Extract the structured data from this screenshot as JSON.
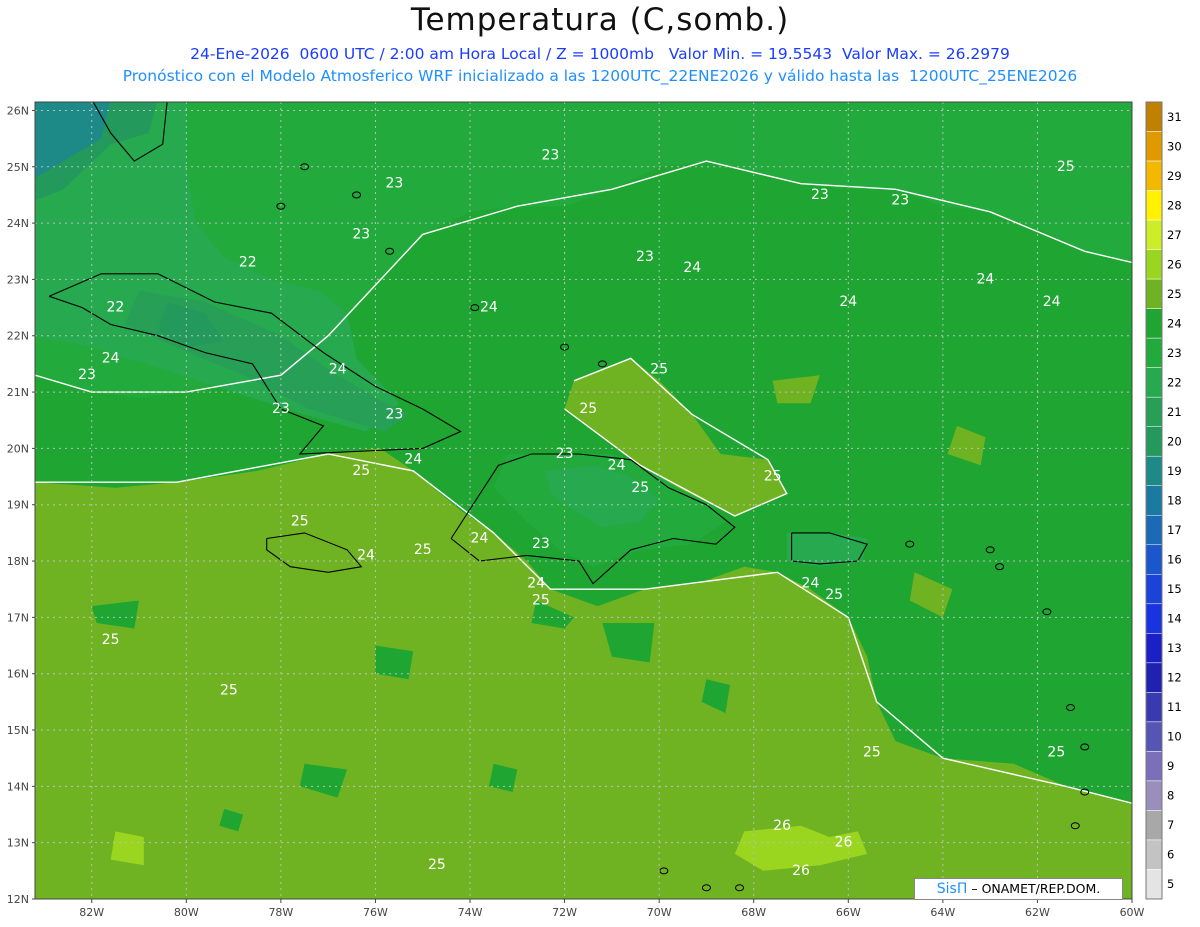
{
  "header": {
    "title": "Temperatura (C,somb.)",
    "line1": "24-Ene-2026  0600 UTC / 2:00 am Hora Local / Z = 1000mb   Valor Min. = 19.5543  Valor Max. = 26.2979",
    "line2": "Pronóstico con el Modelo Atmosferico WRF inicializado a las 1200UTC_22ENE2026 y válido hasta las  1200UTC_25ENE2026"
  },
  "map": {
    "lat_labels": [
      "26N",
      "25N",
      "24N",
      "23N",
      "22N",
      "21N",
      "20N",
      "19N",
      "18N",
      "17N",
      "16N",
      "15N",
      "14N",
      "13N",
      "12N"
    ],
    "lon_labels": [
      "82W",
      "80W",
      "78W",
      "76W",
      "74W",
      "72W",
      "70W",
      "68W",
      "66W",
      "64W",
      "62W",
      "60W"
    ],
    "colors": {
      "c19": "#1e8a87",
      "c20": "#239a5c",
      "c21": "#279f57",
      "c22": "#26a94f",
      "c23": "#22aa3c",
      "c24": "#1fa632",
      "c25": "#70b322",
      "c26": "#9ad61f",
      "grid": "#bdbdbd",
      "contour": "#ffffff",
      "coast": "#000000"
    },
    "contour_labels": [
      {
        "text": "23",
        "lon": -72.3,
        "lat": 25.2
      },
      {
        "text": "23",
        "lon": -75.6,
        "lat": 24.7
      },
      {
        "text": "23",
        "lon": -76.3,
        "lat": 23.8
      },
      {
        "text": "22",
        "lon": -78.7,
        "lat": 23.3
      },
      {
        "text": "22",
        "lon": -81.5,
        "lat": 22.5
      },
      {
        "text": "24",
        "lon": -81.6,
        "lat": 21.6
      },
      {
        "text": "23",
        "lon": -82.1,
        "lat": 21.3
      },
      {
        "text": "24",
        "lon": -73.6,
        "lat": 22.5
      },
      {
        "text": "24",
        "lon": -76.8,
        "lat": 21.4
      },
      {
        "text": "23",
        "lon": -78.0,
        "lat": 20.7
      },
      {
        "text": "23",
        "lon": -75.6,
        "lat": 20.6
      },
      {
        "text": "24",
        "lon": -75.2,
        "lat": 19.8
      },
      {
        "text": "25",
        "lon": -76.3,
        "lat": 19.6
      },
      {
        "text": "24",
        "lon": -69.3,
        "lat": 23.2
      },
      {
        "text": "25",
        "lon": -70.0,
        "lat": 21.4
      },
      {
        "text": "25",
        "lon": -71.5,
        "lat": 20.7
      },
      {
        "text": "23",
        "lon": -72.0,
        "lat": 19.9
      },
      {
        "text": "24",
        "lon": -70.9,
        "lat": 19.7
      },
      {
        "text": "25",
        "lon": -70.4,
        "lat": 19.3
      },
      {
        "text": "25",
        "lon": -67.6,
        "lat": 19.5
      },
      {
        "text": "23",
        "lon": -70.3,
        "lat": 23.4
      },
      {
        "text": "23",
        "lon": -66.6,
        "lat": 24.5
      },
      {
        "text": "23",
        "lon": -64.9,
        "lat": 24.4
      },
      {
        "text": "24",
        "lon": -66.0,
        "lat": 22.6
      },
      {
        "text": "24",
        "lon": -63.1,
        "lat": 23.0
      },
      {
        "text": "24",
        "lon": -61.7,
        "lat": 22.6
      },
      {
        "text": "25",
        "lon": -61.4,
        "lat": 25.0
      },
      {
        "text": "25",
        "lon": -77.6,
        "lat": 18.7
      },
      {
        "text": "24",
        "lon": -76.2,
        "lat": 18.1
      },
      {
        "text": "25",
        "lon": -75.0,
        "lat": 18.2
      },
      {
        "text": "24",
        "lon": -73.8,
        "lat": 18.4
      },
      {
        "text": "23",
        "lon": -72.5,
        "lat": 18.3
      },
      {
        "text": "24",
        "lon": -72.6,
        "lat": 17.6
      },
      {
        "text": "25",
        "lon": -72.5,
        "lat": 17.3
      },
      {
        "text": "24",
        "lon": -66.8,
        "lat": 17.6
      },
      {
        "text": "25",
        "lon": -66.3,
        "lat": 17.4
      },
      {
        "text": "25",
        "lon": -81.6,
        "lat": 16.6
      },
      {
        "text": "25",
        "lon": -79.1,
        "lat": 15.7
      },
      {
        "text": "25",
        "lon": -65.5,
        "lat": 14.6
      },
      {
        "text": "25",
        "lon": -61.6,
        "lat": 14.6
      },
      {
        "text": "26",
        "lon": -67.4,
        "lat": 13.3
      },
      {
        "text": "26",
        "lon": -66.1,
        "lat": 13.0
      },
      {
        "text": "25",
        "lon": -74.7,
        "lat": 12.6
      },
      {
        "text": "26",
        "lon": -67.0,
        "lat": 12.5
      }
    ]
  },
  "legend": {
    "values": [
      "31",
      "30",
      "29",
      "28",
      "27",
      "26",
      "25",
      "24",
      "23",
      "22",
      "21",
      "20",
      "19",
      "18",
      "17",
      "16",
      "15",
      "14",
      "13",
      "12",
      "11",
      "10",
      "9",
      "8",
      "7",
      "6",
      "5"
    ],
    "colors": [
      "#c08000",
      "#e09a00",
      "#f5b800",
      "#fff100",
      "#cdee27",
      "#9ad61f",
      "#70b322",
      "#1fa632",
      "#22aa3c",
      "#26a94f",
      "#279f57",
      "#239a5c",
      "#1e8a87",
      "#1a7a9f",
      "#1a6ab8",
      "#1a56cc",
      "#1a44d9",
      "#1a33e0",
      "#1a1fc8",
      "#1f22b0",
      "#3a3ab0",
      "#5555b5",
      "#7a6fb8",
      "#9a8fbc",
      "#a8a8a8",
      "#c3c3c3",
      "#e4e4e4"
    ]
  },
  "credit": {
    "brand": "SisΠ",
    "text": " – ONAMET/REP.DOM."
  }
}
